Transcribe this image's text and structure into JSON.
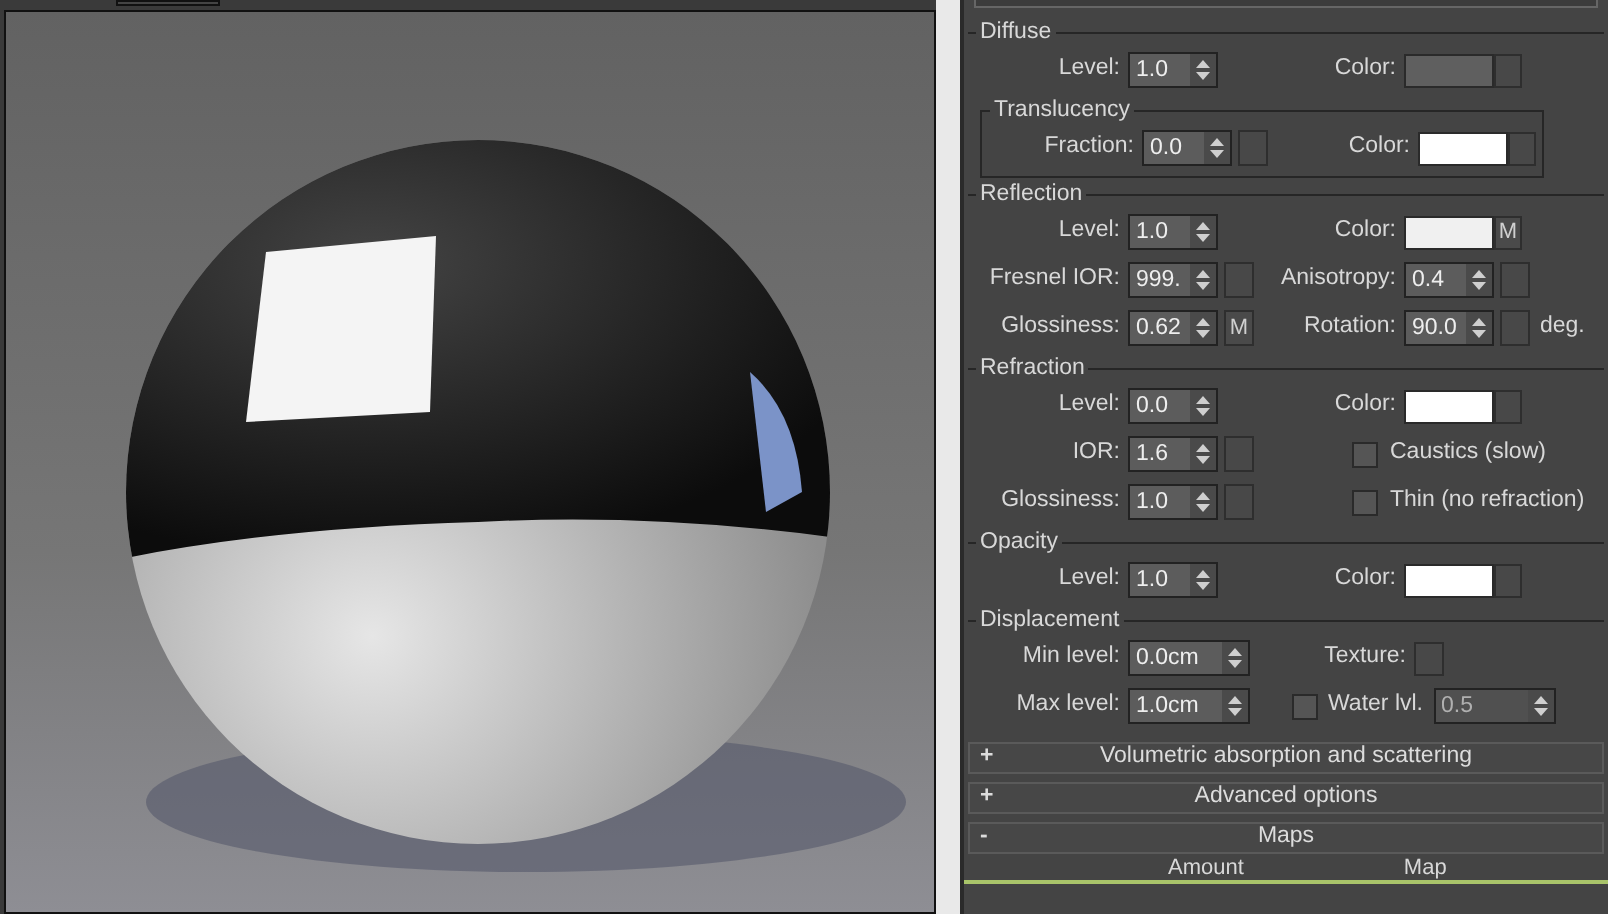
{
  "groups": [
    {
      "title": "Diffuse",
      "rows": [
        {
          "left": {
            "kind": "spinner",
            "label": "Level:",
            "value": "1.0"
          },
          "right": {
            "kind": "color",
            "label": "Color:",
            "color": "#5f5f5f"
          }
        }
      ],
      "subgroup": {
        "title": "Translucency",
        "rows": [
          {
            "left": {
              "kind": "spinner",
              "label": "Fraction:",
              "value": "0.0",
              "map_slot": true
            },
            "right": {
              "kind": "color",
              "label": "Color:",
              "color": "#ffffff"
            }
          }
        ]
      }
    },
    {
      "title": "Reflection",
      "rows": [
        {
          "left": {
            "kind": "spinner",
            "label": "Level:",
            "value": "1.0"
          },
          "right": {
            "kind": "color",
            "label": "Color:",
            "color": "#f0f0f0",
            "map_button": "M"
          }
        },
        {
          "left": {
            "kind": "spinner",
            "label": "Fresnel IOR:",
            "value": "999.",
            "map_slot": true
          },
          "right": {
            "kind": "spinner",
            "label": "Anisotropy:",
            "value": "0.4",
            "map_slot": true
          }
        },
        {
          "left": {
            "kind": "spinner",
            "label": "Glossiness:",
            "value": "0.62",
            "map_button": "M"
          },
          "right": {
            "kind": "spinner",
            "label": "Rotation:",
            "value": "90.0",
            "map_slot": true,
            "suffix": "deg."
          }
        }
      ]
    },
    {
      "title": "Refraction",
      "rows": [
        {
          "left": {
            "kind": "spinner",
            "label": "Level:",
            "value": "0.0"
          },
          "right": {
            "kind": "color",
            "label": "Color:",
            "color": "#ffffff"
          }
        },
        {
          "left": {
            "kind": "spinner",
            "label": "IOR:",
            "value": "1.6",
            "map_slot": true
          },
          "right": {
            "kind": "checkbox",
            "label": "Caustics (slow)",
            "checked": false
          }
        },
        {
          "left": {
            "kind": "spinner",
            "label": "Glossiness:",
            "value": "1.0",
            "map_slot": true
          },
          "right": {
            "kind": "checkbox",
            "label": "Thin (no refraction)",
            "checked": false
          }
        }
      ]
    },
    {
      "title": "Opacity",
      "rows": [
        {
          "left": {
            "kind": "spinner",
            "label": "Level:",
            "value": "1.0"
          },
          "right": {
            "kind": "color",
            "label": "Color:",
            "color": "#ffffff"
          }
        }
      ]
    },
    {
      "title": "Displacement",
      "rows": [
        {
          "left": {
            "kind": "spinner",
            "label": "Min level:",
            "value": "0.0cm"
          },
          "right": {
            "kind": "texture",
            "label": "Texture:"
          }
        },
        {
          "left": {
            "kind": "spinner",
            "label": "Max level:",
            "value": "1.0cm"
          },
          "right": {
            "kind": "toggle_spinner",
            "label": "Water lvl.",
            "checked": false,
            "value": "0.5",
            "disabled": true
          }
        }
      ]
    }
  ],
  "rollouts": [
    {
      "sign": "+",
      "title": "Volumetric absorption and scattering"
    },
    {
      "sign": "+",
      "title": "Advanced options"
    },
    {
      "sign": "-",
      "title": "Maps"
    }
  ],
  "maps_columns": [
    "Amount",
    "Map"
  ]
}
